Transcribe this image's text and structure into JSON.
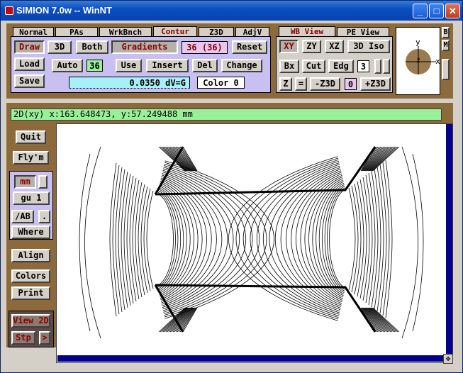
{
  "window": {
    "title": "SIMION 7.0w -- WinNT",
    "min": "_",
    "max": "□",
    "close": "✕"
  },
  "tabs": [
    "Normal",
    "PAs",
    "WrkBnch",
    "Contur",
    "Z3D",
    "AdjV"
  ],
  "view_tabs": [
    "WB View",
    "PE View"
  ],
  "contour": {
    "draw": "Draw",
    "threed": "3D",
    "both": "Both",
    "gradients": "Gradients",
    "count_display": "36 (36)",
    "reset": "Reset",
    "load": "Load",
    "save": "Save",
    "auto": "Auto",
    "auto_value": "36",
    "use": "Use",
    "insert": "Insert",
    "del": "Del",
    "change": "Change",
    "dv_value": "0.0350 dV=G",
    "color": "Color 0"
  },
  "view": {
    "xy": "XY",
    "zy": "ZY",
    "xz": "XZ",
    "iso": "3D Iso",
    "bx": "Bx",
    "cut": "Cut",
    "edg": "Edg",
    "edg_value": "3",
    "z": "Z",
    "eq": "=",
    "minus_z3d": "-Z3D",
    "z3d_value": "0",
    "plus_z3d": "+Z3D"
  },
  "orient": {
    "y": "y",
    "z": "z",
    "x": "x",
    "b": "B",
    "m": "M"
  },
  "status": "2D(xy) x:163.648473, y:57.249488 mm",
  "left": {
    "quit": "Quit",
    "flym": "Fly'm",
    "mm": "mm",
    "gu": "gu  1",
    "ab": "/AB",
    "dot": ".",
    "where": "Where",
    "align": "Align",
    "colors": "Colors",
    "print": "Print",
    "view2d": "View 2D",
    "stp": "Stp",
    "arrow": ">"
  },
  "colors": {
    "panel": "#8c6a3c",
    "status": "#98f098",
    "scroll": "#00008b",
    "accent": "#8b0000"
  }
}
